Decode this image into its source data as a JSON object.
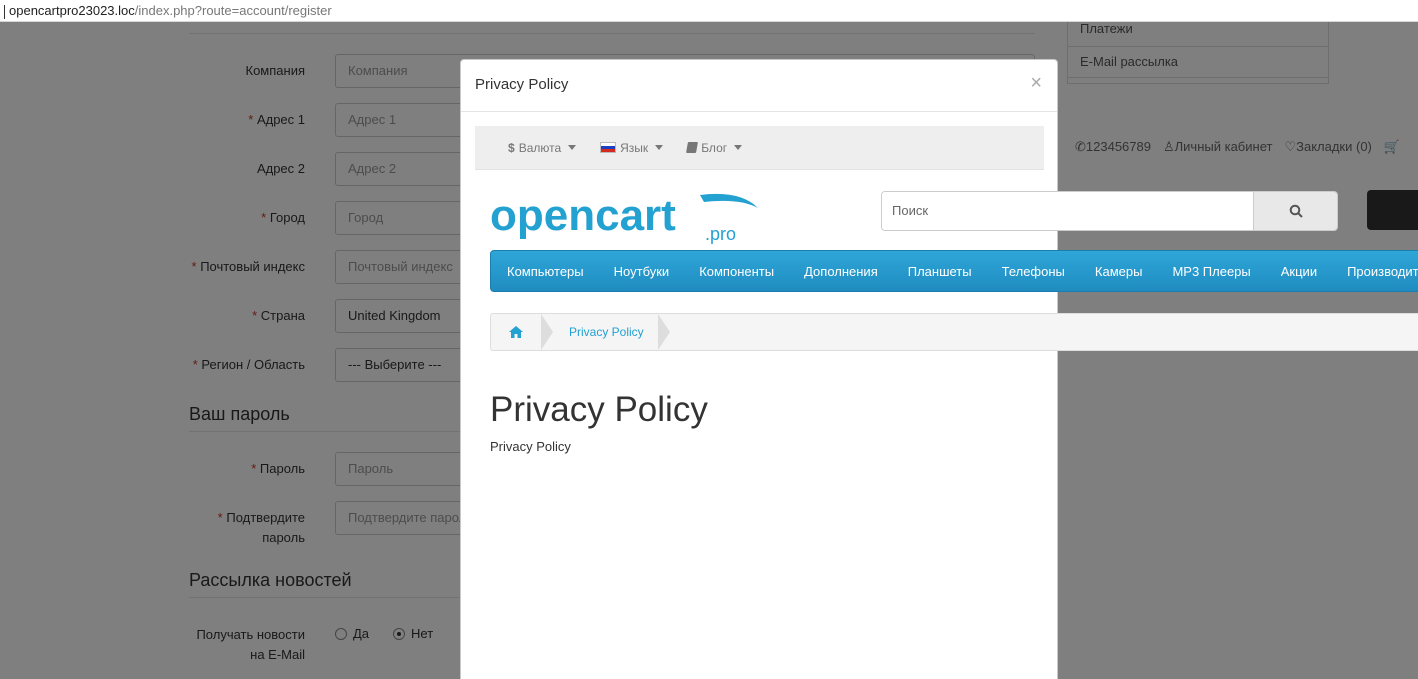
{
  "browser": {
    "url_host": "opencartpro23023.loc",
    "url_path": "/index.php?route=account/register"
  },
  "form": {
    "fields": [
      {
        "label": "Компания",
        "required": false,
        "placeholder": "Компания"
      },
      {
        "label": "Адрес 1",
        "required": true,
        "placeholder": "Адрес 1"
      },
      {
        "label": "Адрес 2",
        "required": false,
        "placeholder": "Адрес 2"
      },
      {
        "label": "Город",
        "required": true,
        "placeholder": "Город"
      },
      {
        "label": "Почтовый индекс",
        "required": true,
        "placeholder": "Почтовый индекс"
      },
      {
        "label": "Страна",
        "required": true,
        "value": "United Kingdom"
      },
      {
        "label": "Регион / Область",
        "required": true,
        "value": "--- Выберите ---"
      }
    ],
    "password_section": {
      "title": "Ваш пароль",
      "password_label": "Пароль",
      "password_placeholder": "Пароль",
      "confirm_label_1": "Подтвердите",
      "confirm_label_2": "пароль",
      "confirm_placeholder": "Подтвердите пароль"
    },
    "newsletter_section": {
      "title": "Рассылка новостей",
      "label_1": "Получать новости",
      "label_2": "на E-Mail",
      "opt_yes": "Да",
      "opt_no": "Нет",
      "selected": "Нет"
    },
    "required_mark": "*"
  },
  "sidebar": {
    "items": [
      "Платежи",
      "E-Mail рассылка"
    ]
  },
  "topinfo": {
    "phone": "123456789",
    "account": "Личный кабинет",
    "wishlist": "Закладки (0)"
  },
  "modal": {
    "title": "Privacy Policy",
    "close": "×",
    "embed": {
      "topbar": {
        "currency": "Валюта",
        "currency_symbol": "$",
        "language": "Язык",
        "blog": "Блог"
      },
      "logo": {
        "main": "opencart",
        "sub": ".pro"
      },
      "search_placeholder": "Поиск",
      "menu": [
        "Компьютеры",
        "Ноутбуки",
        "Компоненты",
        "Дополнения",
        "Планшеты",
        "Телефоны",
        "Камеры",
        "MP3 Плееры",
        "Акции",
        "Производители"
      ],
      "breadcrumb": {
        "current": "Privacy Policy"
      },
      "heading": "Privacy Policy",
      "body": "Privacy Policy"
    }
  },
  "colors": {
    "brand_blue": "#23a1d1",
    "nav_blue": "#229ac8",
    "required_red": "#c0392b"
  }
}
